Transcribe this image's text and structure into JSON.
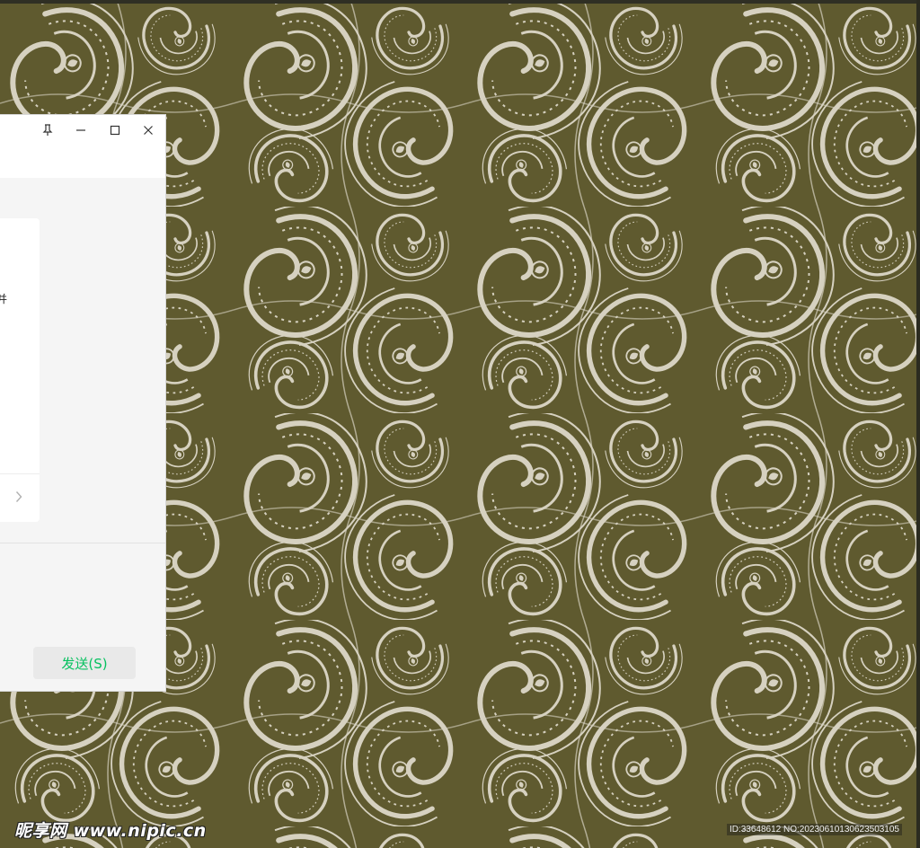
{
  "wallpaper": {
    "colors": {
      "base": "#5f5a2f",
      "light": "#d6d1c0",
      "dark": "#3e3a1c"
    },
    "pattern_icon": "paisley-pattern"
  },
  "chat_window": {
    "title_bar": {
      "pin_icon": "pin-icon",
      "minimize_icon": "minimize-icon",
      "maximize_icon": "maximize-icon",
      "close_icon": "close-icon"
    },
    "card": {
      "partial_text": "并",
      "chevron_icon": "chevron-right-icon"
    },
    "send_button_label": "发送(S)",
    "colors": {
      "accent": "#07c160",
      "window_bg": "#f5f5f5",
      "title_bg": "#ffffff"
    }
  },
  "watermark": {
    "logo_text": "昵享网 www.nipic.cn",
    "id_text": "ID:33648612 NO:20230610130623503105"
  }
}
